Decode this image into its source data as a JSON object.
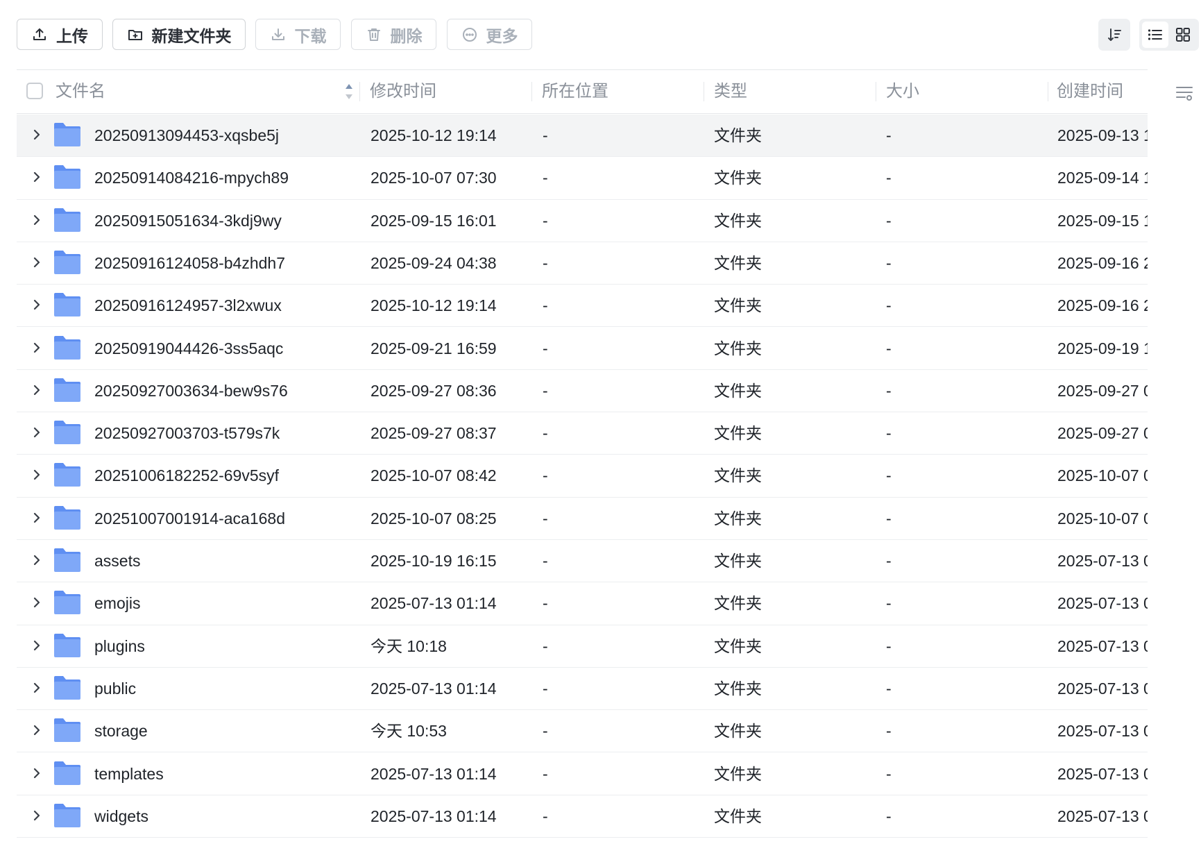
{
  "toolbar": {
    "upload_label": "上传",
    "new_folder_label": "新建文件夹",
    "download_label": "下载",
    "delete_label": "删除",
    "more_label": "更多"
  },
  "table": {
    "headers": {
      "name": "文件名",
      "modified": "修改时间",
      "location": "所在位置",
      "type": "类型",
      "size": "大小",
      "created": "创建时间"
    },
    "rows": [
      {
        "name": "20250913094453-xqsbe5j",
        "modified": "2025-10-12 19:14",
        "location": "-",
        "type": "文件夹",
        "size": "-",
        "created": "2025-09-13 1"
      },
      {
        "name": "20250914084216-mpych89",
        "modified": "2025-10-07 07:30",
        "location": "-",
        "type": "文件夹",
        "size": "-",
        "created": "2025-09-14 1"
      },
      {
        "name": "20250915051634-3kdj9wy",
        "modified": "2025-09-15 16:01",
        "location": "-",
        "type": "文件夹",
        "size": "-",
        "created": "2025-09-15 1"
      },
      {
        "name": "20250916124058-b4zhdh7",
        "modified": "2025-09-24 04:38",
        "location": "-",
        "type": "文件夹",
        "size": "-",
        "created": "2025-09-16 2"
      },
      {
        "name": "20250916124957-3l2xwux",
        "modified": "2025-10-12 19:14",
        "location": "-",
        "type": "文件夹",
        "size": "-",
        "created": "2025-09-16 2"
      },
      {
        "name": "20250919044426-3ss5aqc",
        "modified": "2025-09-21 16:59",
        "location": "-",
        "type": "文件夹",
        "size": "-",
        "created": "2025-09-19 1"
      },
      {
        "name": "20250927003634-bew9s76",
        "modified": "2025-09-27 08:36",
        "location": "-",
        "type": "文件夹",
        "size": "-",
        "created": "2025-09-27 0"
      },
      {
        "name": "20250927003703-t579s7k",
        "modified": "2025-09-27 08:37",
        "location": "-",
        "type": "文件夹",
        "size": "-",
        "created": "2025-09-27 0"
      },
      {
        "name": "20251006182252-69v5syf",
        "modified": "2025-10-07 08:42",
        "location": "-",
        "type": "文件夹",
        "size": "-",
        "created": "2025-10-07 0"
      },
      {
        "name": "20251007001914-aca168d",
        "modified": "2025-10-07 08:25",
        "location": "-",
        "type": "文件夹",
        "size": "-",
        "created": "2025-10-07 0"
      },
      {
        "name": "assets",
        "modified": "2025-10-19 16:15",
        "location": "-",
        "type": "文件夹",
        "size": "-",
        "created": "2025-07-13 0"
      },
      {
        "name": "emojis",
        "modified": "2025-07-13 01:14",
        "location": "-",
        "type": "文件夹",
        "size": "-",
        "created": "2025-07-13 0"
      },
      {
        "name": "plugins",
        "modified": "今天 10:18",
        "location": "-",
        "type": "文件夹",
        "size": "-",
        "created": "2025-07-13 0"
      },
      {
        "name": "public",
        "modified": "2025-07-13 01:14",
        "location": "-",
        "type": "文件夹",
        "size": "-",
        "created": "2025-07-13 0"
      },
      {
        "name": "storage",
        "modified": "今天 10:53",
        "location": "-",
        "type": "文件夹",
        "size": "-",
        "created": "2025-07-13 0"
      },
      {
        "name": "templates",
        "modified": "2025-07-13 01:14",
        "location": "-",
        "type": "文件夹",
        "size": "-",
        "created": "2025-07-13 0"
      },
      {
        "name": "widgets",
        "modified": "2025-07-13 01:14",
        "location": "-",
        "type": "文件夹",
        "size": "-",
        "created": "2025-07-13 0"
      }
    ]
  },
  "icons": {
    "folder_color": "#7fa8f8",
    "folder_tab_color": "#5f8ff2",
    "text_color": "#1f2329",
    "muted_color": "#8a9099"
  }
}
